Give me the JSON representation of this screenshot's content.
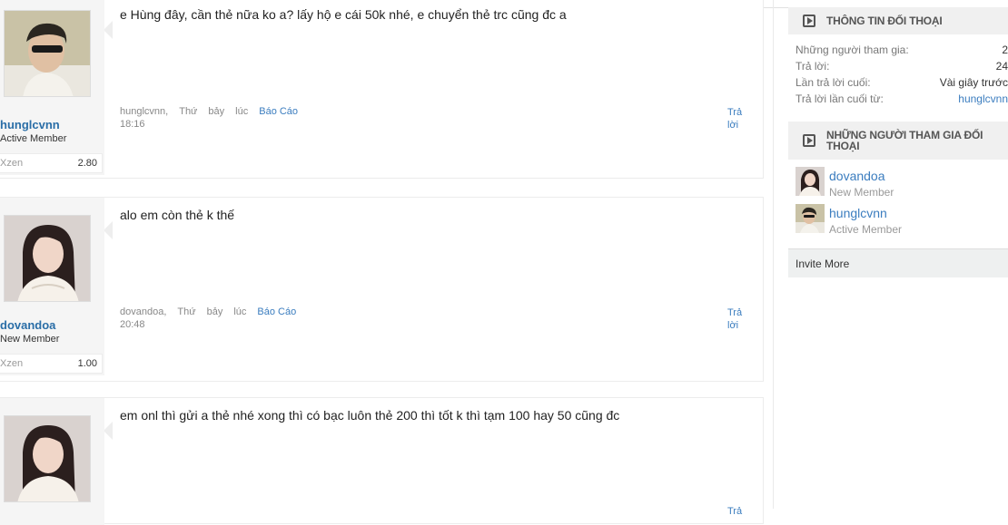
{
  "posts": [
    {
      "username": "hunglcvnn",
      "user_title": "Active Member",
      "xzen_label": "Xzen",
      "xzen_value": "2.80",
      "message": "e Hùng đây, cần thẻ nữa ko a? lấy hộ e cái 50k nhé, e chuyển thẻ trc cũng đc a",
      "meta_user": "hunglcvnn,",
      "meta_day": "Thứ",
      "meta_day2": "bảy",
      "meta_at": "lúc",
      "report": "Báo Cáo",
      "time": "18:16",
      "reply": "Trả lời"
    },
    {
      "username": "dovandoa",
      "user_title": "New Member",
      "xzen_label": "Xzen",
      "xzen_value": "1.00",
      "message": "alo em còn thẻ k thế",
      "meta_user": "dovandoa,",
      "meta_day": "Thứ",
      "meta_day2": "bảy",
      "meta_at": "lúc",
      "report": "Báo Cáo",
      "time": "20:48",
      "reply": "Trả lời"
    },
    {
      "username": "",
      "user_title": "",
      "message": "em onl thì gửi a thẻ nhé xong thì có bạc luôn thẻ 200 thì tốt k thì tạm 100 hay 50 cũng đc",
      "reply": "Trả"
    }
  ],
  "sidebar": {
    "info": {
      "title": "THÔNG TIN ĐỐI THOẠI",
      "icon": "play-box-icon",
      "rows": [
        {
          "label": "Những người tham gia:",
          "value": "2"
        },
        {
          "label": "Trả lời:",
          "value": "24"
        },
        {
          "label": "Lần trả lời cuối:",
          "value": "Vài giây trước"
        },
        {
          "label": "Trả lời lần cuối từ:",
          "value": "hunglcvnn"
        }
      ]
    },
    "participants": {
      "title": "NHỮNG NGƯỜI THAM GIA ĐỐI THOẠI",
      "icon": "play-box-icon",
      "members": [
        {
          "name": "dovandoa",
          "title": "New Member"
        },
        {
          "name": "hunglcvnn",
          "title": "Active Member"
        }
      ],
      "invite_label": "Invite More"
    }
  },
  "colors": {
    "link": "#3b7dbf",
    "username": "#2a6ea7",
    "sidebar_header_bg": "#f0f0f0"
  }
}
